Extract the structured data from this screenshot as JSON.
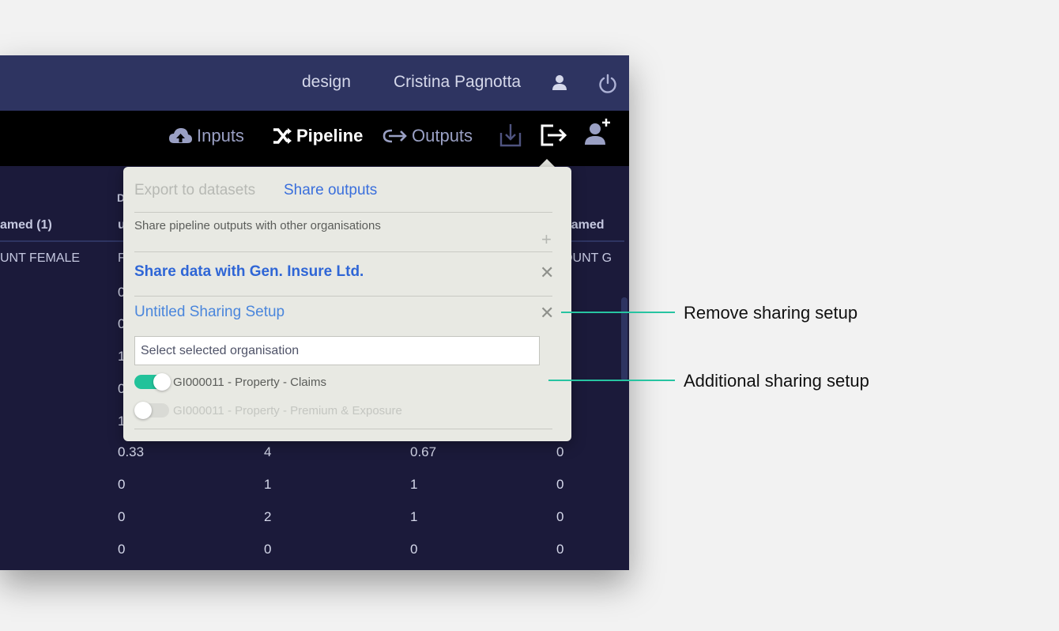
{
  "topbar": {
    "environment": "design",
    "user_name": "Cristina Pagnotta"
  },
  "toolbar": {
    "inputs_label": "Inputs",
    "pipeline_label": "Pipeline",
    "outputs_label": "Outputs"
  },
  "table": {
    "headers": [
      "amed (1)",
      "u",
      "named"
    ],
    "subheaders": [
      "UNT FEMALE",
      "F",
      "DUNT G"
    ],
    "partial_col_letter": "D",
    "left_partial_col": [
      "0",
      "0",
      "1",
      "0",
      "1"
    ],
    "rows": [
      [
        "0.33",
        "4",
        "0.67",
        "0"
      ],
      [
        "0",
        "1",
        "1",
        "0"
      ],
      [
        "0",
        "2",
        "1",
        "0"
      ],
      [
        "0",
        "0",
        "0",
        "0"
      ]
    ]
  },
  "popup": {
    "tab_export": "Export to datasets",
    "tab_share": "Share outputs",
    "description": "Share pipeline outputs with other organisations",
    "add_symbol": "+",
    "setups": [
      {
        "name": "Share data with Gen. Insure Ltd."
      },
      {
        "name": "Untitled Sharing Setup"
      }
    ],
    "close_symbol": "✕",
    "select_value": "Select selected organisation",
    "toggles": [
      {
        "label": "GI000011 - Property - Claims",
        "on": true
      },
      {
        "label": "GI000011 - Property - Premium & Exposure",
        "on": false
      }
    ]
  },
  "callouts": {
    "remove": "Remove sharing setup",
    "additional": "Additional sharing setup"
  },
  "colors": {
    "accent_teal": "#27c4a1",
    "link_blue": "#3a6fdc",
    "topbar_bg": "#2e3461",
    "table_bg": "#1b1a3a"
  }
}
